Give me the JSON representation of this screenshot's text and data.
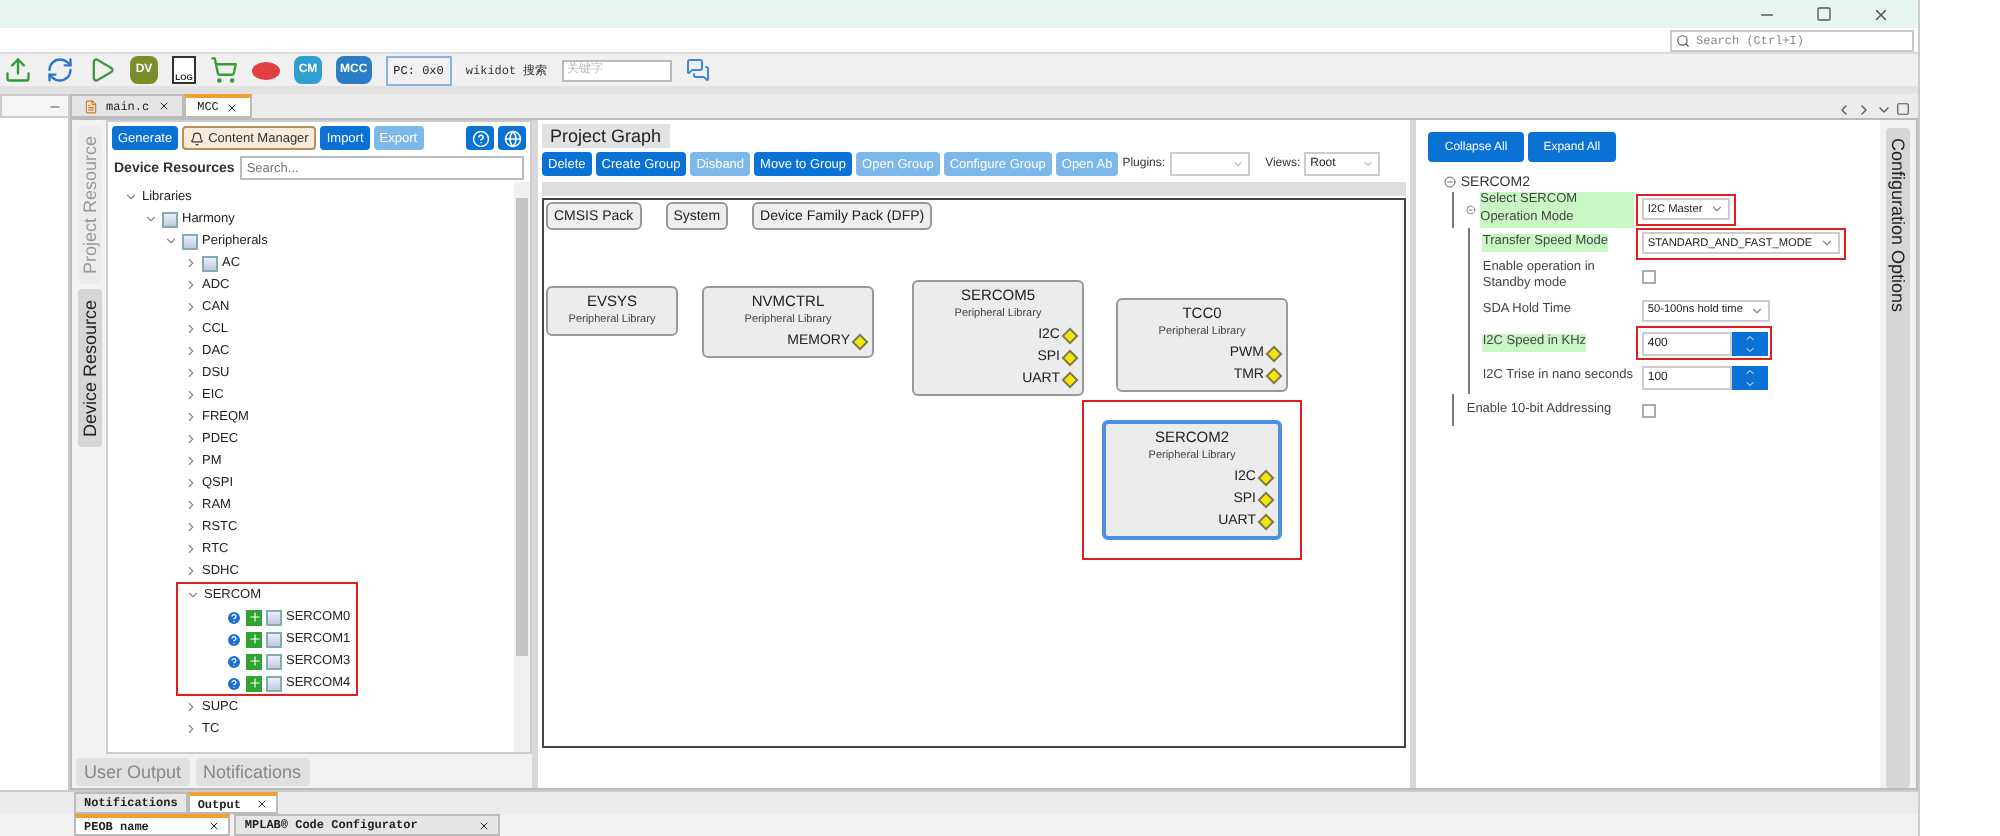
{
  "search": {
    "placeholder": "Search (Ctrl+I)"
  },
  "toolbar": {
    "items": [
      {
        "kind": "upload"
      },
      {
        "kind": "refresh"
      },
      {
        "kind": "run"
      },
      {
        "kind": "badge",
        "label": "DV",
        "color": "#7a8f2a"
      },
      {
        "kind": "log",
        "label": "LOG"
      },
      {
        "kind": "cart"
      },
      {
        "kind": "oval"
      },
      {
        "kind": "badge",
        "label": "CM",
        "color": "#2e9fd0"
      },
      {
        "kind": "badge",
        "label": "MCC",
        "color": "#2c7cc6"
      }
    ],
    "pc": "PC: 0x0",
    "site_label": "wikidot 搜索",
    "keyword_placeholder": "关键字"
  },
  "editor_tabs": [
    {
      "label": "main.c",
      "selected": false
    },
    {
      "label": "MCC",
      "selected": true
    }
  ],
  "side_tabs": [
    {
      "label": "Project Resource",
      "selected": false
    },
    {
      "label": "Device Resource",
      "selected": true
    }
  ],
  "device_panel": {
    "buttons": [
      {
        "label": "Generate",
        "kind": "primary",
        "disabled": false
      },
      {
        "label": "Content Manager",
        "kind": "outline",
        "disabled": false
      },
      {
        "label": "Import",
        "kind": "primary",
        "disabled": false
      },
      {
        "label": "Export",
        "kind": "primary",
        "disabled": true
      }
    ],
    "search_label": "Device Resources",
    "search_placeholder": "Search...",
    "tree": [
      {
        "label": "Libraries",
        "kind": "group",
        "expanded": true,
        "highlighted": false,
        "children": [
          {
            "label": "Harmony",
            "kind": "library",
            "expanded": true,
            "highlighted": false,
            "children": [
              {
                "label": "Peripherals",
                "kind": "library",
                "expanded": true,
                "highlighted": false,
                "children": [
                  {
                    "label": "AC",
                    "kind": "library",
                    "expanded": false,
                    "highlighted": false
                  },
                  {
                    "label": "ADC",
                    "kind": "group",
                    "expanded": false,
                    "highlighted": false
                  },
                  {
                    "label": "CAN",
                    "kind": "group",
                    "expanded": false,
                    "highlighted": false
                  },
                  {
                    "label": "CCL",
                    "kind": "group",
                    "expanded": false,
                    "highlighted": false
                  },
                  {
                    "label": "DAC",
                    "kind": "group",
                    "expanded": false,
                    "highlighted": false
                  },
                  {
                    "label": "DSU",
                    "kind": "group",
                    "expanded": false,
                    "highlighted": false
                  },
                  {
                    "label": "EIC",
                    "kind": "group",
                    "expanded": false,
                    "highlighted": false
                  },
                  {
                    "label": "FREQM",
                    "kind": "group",
                    "expanded": false,
                    "highlighted": false
                  },
                  {
                    "label": "PDEC",
                    "kind": "group",
                    "expanded": false,
                    "highlighted": false
                  },
                  {
                    "label": "PM",
                    "kind": "group",
                    "expanded": false,
                    "highlighted": false
                  },
                  {
                    "label": "QSPI",
                    "kind": "group",
                    "expanded": false,
                    "highlighted": false
                  },
                  {
                    "label": "RAM",
                    "kind": "group",
                    "expanded": false,
                    "highlighted": false
                  },
                  {
                    "label": "RSTC",
                    "kind": "group",
                    "expanded": false,
                    "highlighted": false
                  },
                  {
                    "label": "RTC",
                    "kind": "group",
                    "expanded": false,
                    "highlighted": false
                  },
                  {
                    "label": "SDHC",
                    "kind": "group",
                    "expanded": false,
                    "highlighted": false
                  },
                  {
                    "label": "SERCOM",
                    "kind": "group",
                    "expanded": true,
                    "highlighted": true,
                    "children": [
                      {
                        "label": "SERCOM0",
                        "kind": "component"
                      },
                      {
                        "label": "SERCOM1",
                        "kind": "component"
                      },
                      {
                        "label": "SERCOM3",
                        "kind": "component"
                      },
                      {
                        "label": "SERCOM4",
                        "kind": "component"
                      }
                    ]
                  },
                  {
                    "label": "SUPC",
                    "kind": "group",
                    "expanded": false,
                    "highlighted": false
                  },
                  {
                    "label": "TC",
                    "kind": "group",
                    "expanded": false,
                    "highlighted": false
                  }
                ]
              }
            ]
          }
        ]
      }
    ]
  },
  "left_bottom_tabs": [
    {
      "label": "User Output",
      "selected": false
    },
    {
      "label": "Notifications",
      "selected": false
    }
  ],
  "project_graph": {
    "title": "Project Graph",
    "buttons": [
      {
        "label": "Delete",
        "disabled": false
      },
      {
        "label": "Create Group",
        "disabled": false
      },
      {
        "label": "Disband",
        "disabled": true
      },
      {
        "label": "Move to Group",
        "disabled": false
      },
      {
        "label": "Open Group",
        "disabled": true
      },
      {
        "label": "Configure Group",
        "disabled": true
      },
      {
        "label": "Open Ab",
        "disabled": true
      }
    ],
    "plugins_label": "Plugins:",
    "views_label": "Views:",
    "views_value": "Root",
    "packs": [
      "CMSIS Pack",
      "System",
      "Device Family Pack (DFP)"
    ],
    "nodes": [
      {
        "title": "EVSYS",
        "subtitle": "Peripheral Library",
        "selected": false,
        "highlighted": false
      },
      {
        "title": "NVMCTRL",
        "subtitle": "Peripheral Library",
        "ports": [
          "MEMORY"
        ],
        "selected": false,
        "highlighted": false
      },
      {
        "title": "SERCOM5",
        "subtitle": "Peripheral Library",
        "ports": [
          "I2C",
          "SPI",
          "UART"
        ],
        "selected": false,
        "highlighted": false
      },
      {
        "title": "TCC0",
        "subtitle": "Peripheral Library",
        "ports": [
          "PWM",
          "TMR"
        ],
        "selected": false,
        "highlighted": false
      },
      {
        "title": "SERCOM2",
        "subtitle": "Peripheral Library",
        "ports": [
          "I2C",
          "SPI",
          "UART"
        ],
        "selected": true,
        "highlighted": true
      }
    ]
  },
  "configuration": {
    "buttons": [
      "Collapse All",
      "Expand All"
    ],
    "root": "SERCOM2",
    "root_expanded": true,
    "settings": [
      {
        "label": "Select SERCOM Operation Mode",
        "kind": "dropdown",
        "value": "I2C Master",
        "modified": true,
        "highlighted": true,
        "expanded": true,
        "children": [
          {
            "label": "Transfer Speed Mode",
            "kind": "dropdown",
            "value": "STANDARD_AND_FAST_MODE",
            "modified": true,
            "highlighted": true
          },
          {
            "label": "Enable operation in Standby mode",
            "kind": "checkbox",
            "checked": false,
            "modified": false,
            "highlighted": false
          },
          {
            "label": "SDA Hold Time",
            "kind": "dropdown",
            "value": "50-100ns hold time",
            "modified": false,
            "highlighted": false
          },
          {
            "label": "I2C Speed in KHz",
            "kind": "spinner",
            "value": "400",
            "modified": true,
            "highlighted": true
          },
          {
            "label": "I2C Trise in nano seconds",
            "kind": "spinner",
            "value": "100",
            "modified": false,
            "highlighted": false
          }
        ]
      },
      {
        "label": "Enable 10-bit Addressing",
        "kind": "checkbox",
        "checked": false,
        "modified": false,
        "highlighted": false
      }
    ]
  },
  "config_tab": "Configuration Options",
  "output_tabs": [
    {
      "label": "Notifications",
      "selected": false
    },
    {
      "label": "Output",
      "selected": true
    }
  ],
  "bottom_tabs": [
    {
      "label": "PEOB name",
      "selected": true
    },
    {
      "label": "MPLAB® Code Configurator",
      "selected": false
    }
  ]
}
